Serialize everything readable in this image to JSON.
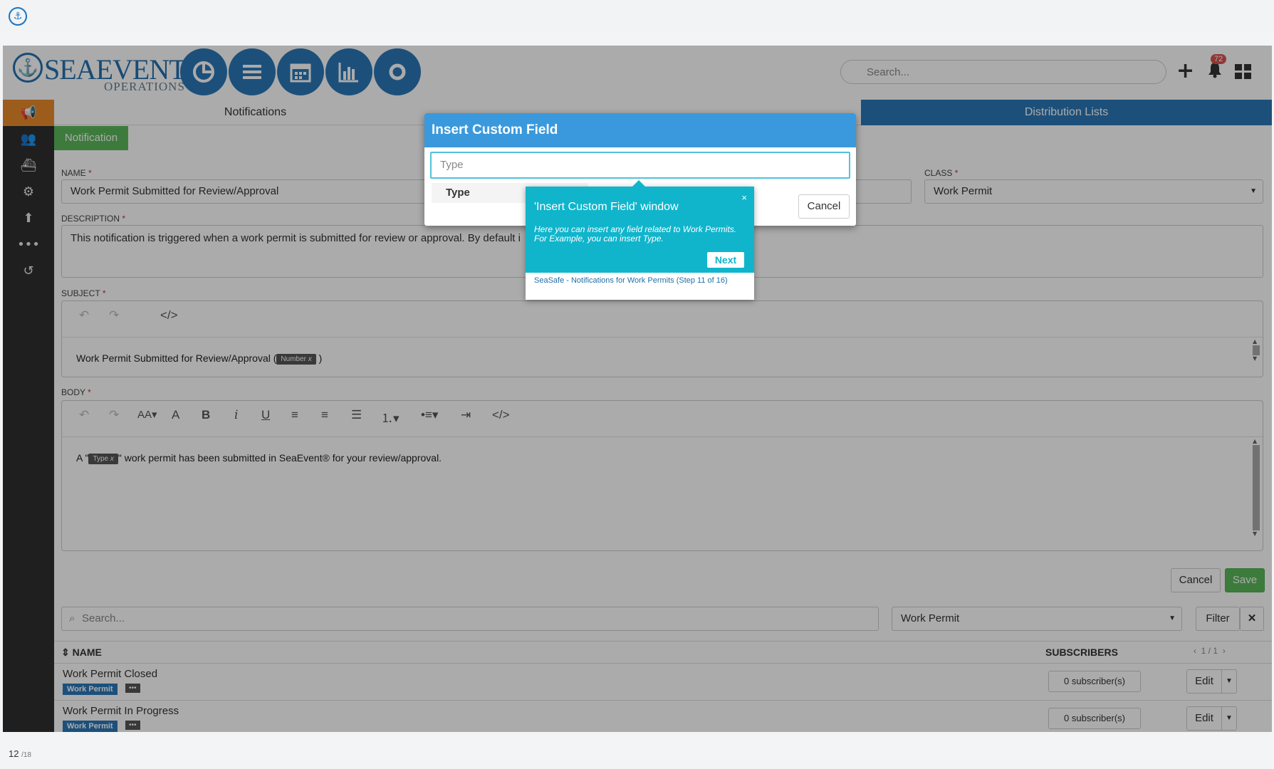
{
  "app": {
    "brand_main": "SEAEVENT",
    "brand_sub": "OPERATIONS",
    "search_placeholder": "Search...",
    "notification_count": "72"
  },
  "tabs": {
    "notifications": "Notifications",
    "distribution_lists": "Distribution Lists"
  },
  "section_chip": "Notification",
  "form": {
    "name_label": "NAME",
    "name_value": "Work Permit Submitted for Review/Approval",
    "class_label": "CLASS",
    "class_value": "Work Permit",
    "description_label": "DESCRIPTION",
    "description_value": "This notification is triggered when a work permit is submitted for review or approval. By default i",
    "subject_label": "SUBJECT",
    "subject_text_before": "Work Permit Submitted for Review/Approval (",
    "subject_tag": "Number",
    "subject_text_after": ")",
    "body_label": "BODY",
    "body_text_before": "A \"",
    "body_tag": "Type",
    "body_text_after": "\" work permit has been submitted in SeaEvent® for your review/approval.",
    "required_mark": "*",
    "tag_remove": "x"
  },
  "toolbar": {
    "font_size": "AA"
  },
  "actions": {
    "cancel": "Cancel",
    "save": "Save"
  },
  "list": {
    "search_placeholder": "Search...",
    "class_filter": "Work Permit",
    "filter_button": "Filter",
    "clear_button": "✕",
    "col_name": "NAME",
    "col_subscribers": "SUBSCRIBERS",
    "pager": "1 / 1",
    "rows": [
      {
        "name": "Work Permit Closed",
        "tag": "Work Permit",
        "subscribers": "0 subscriber(s)",
        "edit": "Edit"
      },
      {
        "name": "Work Permit In Progress",
        "tag": "Work Permit",
        "subscribers": "0 subscriber(s)",
        "edit": "Edit"
      }
    ]
  },
  "dialog": {
    "title": "Insert Custom Field",
    "input_value": "Type",
    "option": "Type",
    "cancel": "Cancel"
  },
  "tour": {
    "title": "'Insert Custom Field' window",
    "text": "Here you can insert any field related to Work Permits. For Example, you can insert Type.",
    "next": "Next",
    "footer": "SeaSafe - Notifications for Work Permits (Step 11 of 16)",
    "close": "×"
  },
  "page": {
    "current": "12",
    "total": "/18"
  },
  "colors": {
    "primary": "#2a78b8",
    "sidebar": "#2f2f2f",
    "active_sidebar": "#e98b2a",
    "success": "#5cb85c",
    "tour": "#10b5cc",
    "dialog_header": "#3a99dc"
  }
}
